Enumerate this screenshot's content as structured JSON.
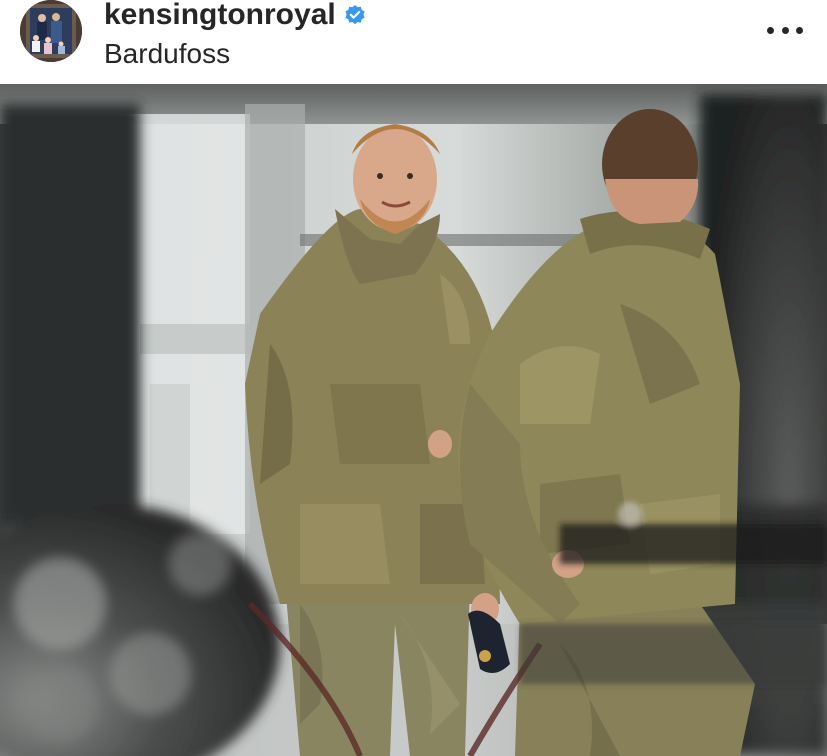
{
  "post_header": {
    "username": "kensingtonroyal",
    "location": "Bardufoss",
    "avatar_icon": "profile-avatar",
    "verified_icon": "verified-badge-icon",
    "more_icon": "more-options-icon",
    "verified_color": "#3897f0"
  },
  "post_image": {
    "description_icon": "post-photo"
  }
}
